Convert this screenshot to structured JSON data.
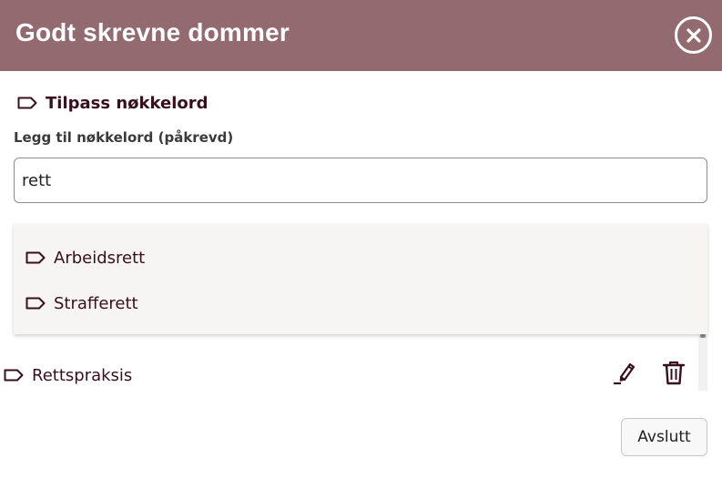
{
  "dialog": {
    "title": "Godt skrevne dommer"
  },
  "section": {
    "title": "Tilpass nøkkelord",
    "icon": "tag-icon"
  },
  "keyword_input": {
    "label": "Legg til nøkkelord (påkrevd)",
    "value": "rett"
  },
  "suggestions": [
    {
      "label": "Arbeidsrett",
      "icon": "tag-icon"
    },
    {
      "label": "Strafferett",
      "icon": "tag-icon"
    }
  ],
  "keywords": [
    {
      "label": "Rettspraksis",
      "icon": "tag-icon"
    }
  ],
  "actions": {
    "finish_label": "Avslutt"
  },
  "colors": {
    "header_bg": "#936a70",
    "accent_text": "#3a0f1d",
    "dropdown_bg": "#f7f5f3"
  }
}
